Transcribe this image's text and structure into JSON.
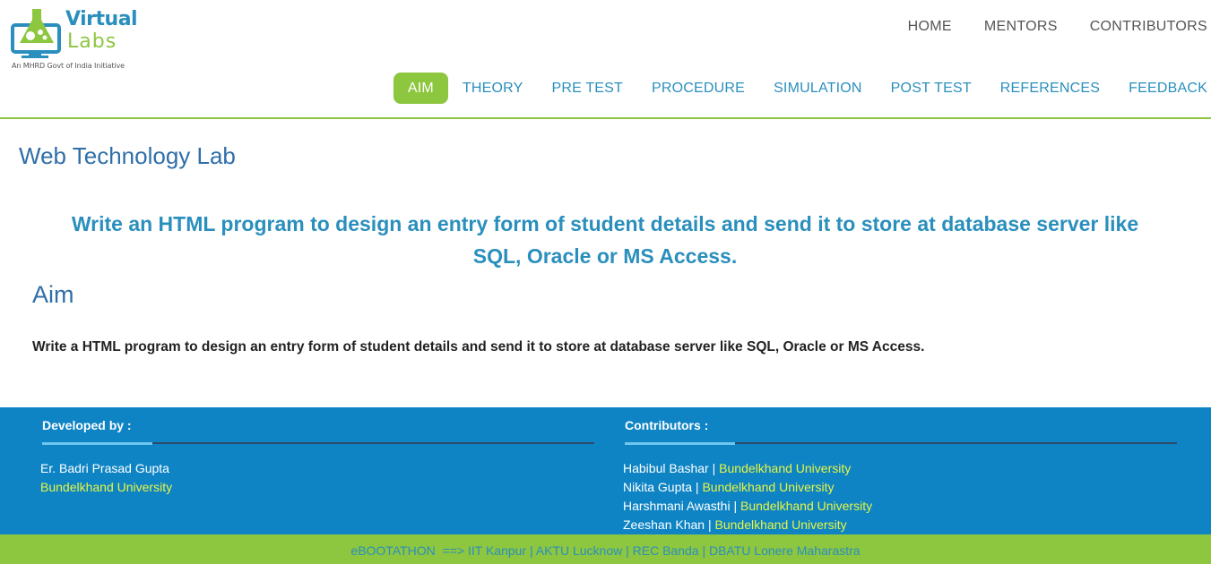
{
  "logo": {
    "virtual": "Virtual",
    "labs": "Labs",
    "caption": "An MHRD Govt of India Initiative"
  },
  "topnav": [
    "HOME",
    "MENTORS",
    "CONTRIBUTORS"
  ],
  "mainnav": [
    "AIM",
    "THEORY",
    "PRE TEST",
    "PROCEDURE",
    "SIMULATION",
    "POST TEST",
    "REFERENCES",
    "FEEDBACK"
  ],
  "active_tab": "AIM",
  "lab_title": "Web Technology Lab",
  "heading_line1": "Write an HTML program to design an entry form of student details and send it to store at database server like",
  "heading_line2": "SQL, Oracle or MS Access.",
  "aim_heading": "Aim",
  "aim_text": "Write a HTML program to design an entry form of student details and send it to store at database server like SQL, Oracle or MS Access.",
  "footer": {
    "developed_by_label": "Developed by :",
    "developer_name": "Er. Badri Prasad Gupta",
    "developer_uni": "Bundelkhand University",
    "contributors_label": "Contributors :",
    "contributors": [
      {
        "name": "Habibul Bashar",
        "uni": "Bundelkhand University"
      },
      {
        "name": "Nikita Gupta",
        "uni": "Bundelkhand University"
      },
      {
        "name": "Harshmani Awasthi",
        "uni": "Bundelkhand University"
      },
      {
        "name": "Zeeshan Khan",
        "uni": "Bundelkhand University"
      }
    ]
  },
  "bottombar": "eBOOTATHON  ==> IIT Kanpur | AKTU Lucknow | REC Banda | DBATU Lonere Maharastra",
  "colors": {
    "green": "#8dc63f",
    "blue": "#2a8fbd",
    "footer_blue": "#0e84c4",
    "yellow": "#e8f542"
  }
}
